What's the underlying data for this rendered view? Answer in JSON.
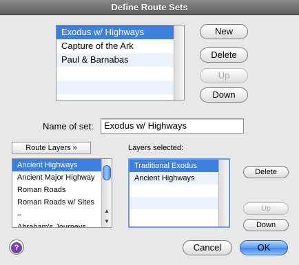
{
  "window": {
    "title": "Define Route Sets"
  },
  "route_sets": {
    "items": [
      "Exodus w/ Highways",
      "Capture of the Ark",
      "Paul & Barnabas"
    ],
    "selected_index": 0
  },
  "route_set_buttons": {
    "new": "New",
    "delete": "Delete",
    "up": "Up",
    "down": "Down"
  },
  "name_of_set": {
    "label": "Name of set:",
    "value": "Exodus w/ Highways"
  },
  "route_layers": {
    "popup_label": "Route Layers »",
    "items": [
      "Ancient Highways",
      "Ancient Major Highway",
      "Roman Roads",
      "Roman Roads w/ Sites",
      "–",
      "Abraham's Journeys"
    ],
    "selected_index": 0
  },
  "layers_selected": {
    "label": "Layers selected:",
    "items": [
      "Traditional Exodus",
      "Ancient Highways"
    ],
    "selected_index": 0
  },
  "layer_buttons": {
    "delete": "Delete",
    "up": "Up",
    "down": "Down"
  },
  "footer": {
    "help": "?",
    "cancel": "Cancel",
    "ok": "OK"
  }
}
